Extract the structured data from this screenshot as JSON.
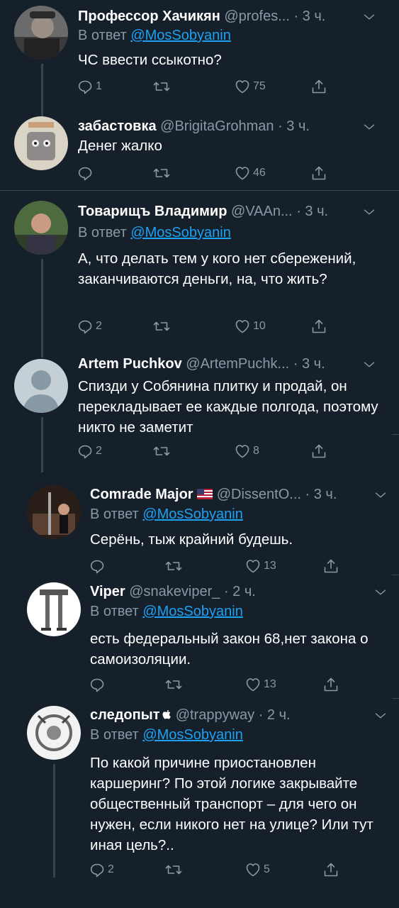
{
  "colors": {
    "background": "#15202b",
    "text": "#ffffff",
    "muted": "#8899a6",
    "link": "#1da1f2",
    "line": "#38444d"
  },
  "tweets": [
    {
      "name": "Профессор Хачикян",
      "handle": "@profes...",
      "time": "· 3 ч.",
      "reply_label": "В ответ",
      "reply_to": "@MosSobyanin",
      "text": "ЧС ввести ссыкотно?",
      "replies": "1",
      "retweets": "",
      "likes": "75"
    },
    {
      "name": "забастовка",
      "handle": "@BrigitaGrohman",
      "time": "· 3 ч.",
      "text": "Денег жалко",
      "replies": "",
      "retweets": "",
      "likes": "46"
    },
    {
      "name": "Товарищъ Владимир",
      "handle": "@VAAn...",
      "time": "· 3 ч.",
      "reply_label": "В ответ",
      "reply_to": "@MosSobyanin",
      "text": "А, что делать тем у кого нет сбережений, заканчиваются деньги, на, что жить?",
      "replies": "2",
      "retweets": "",
      "likes": "10"
    },
    {
      "name": "Artem Puchkov",
      "handle": "@ArtemPuchk...",
      "time": "· 3 ч.",
      "text": "Спизди у Собянина плитку и продай, он перекладывает ее каждые полгода, поэтому никто не заметит",
      "replies": "2",
      "retweets": "",
      "likes": "8"
    },
    {
      "name": "Comrade Major",
      "handle": "@DissentO...",
      "time": "· 3 ч.",
      "reply_label": "В ответ",
      "reply_to": "@MosSobyanin",
      "text": "Серёнь, тыж крайний будешь.",
      "replies": "",
      "retweets": "",
      "likes": "13"
    },
    {
      "name": "Viper",
      "handle": "@snakeviper_",
      "time": "· 2 ч.",
      "reply_label": "В ответ",
      "reply_to": "@MosSobyanin",
      "text": "есть федеральный закон 68,нет закона о самоизоляции.",
      "replies": "",
      "retweets": "",
      "likes": "13"
    },
    {
      "name": "следопыт",
      "handle": "@trappyway",
      "time": "· 2 ч.",
      "reply_label": "В ответ",
      "reply_to": "@MosSobyanin",
      "text": "По какой причине приостановлен каршеринг? По этой логике закрывайте общественный транспорт – для чего он нужен, если никого нет на улице? Или тут иная цель?..",
      "replies": "2",
      "retweets": "",
      "likes": "5"
    }
  ]
}
